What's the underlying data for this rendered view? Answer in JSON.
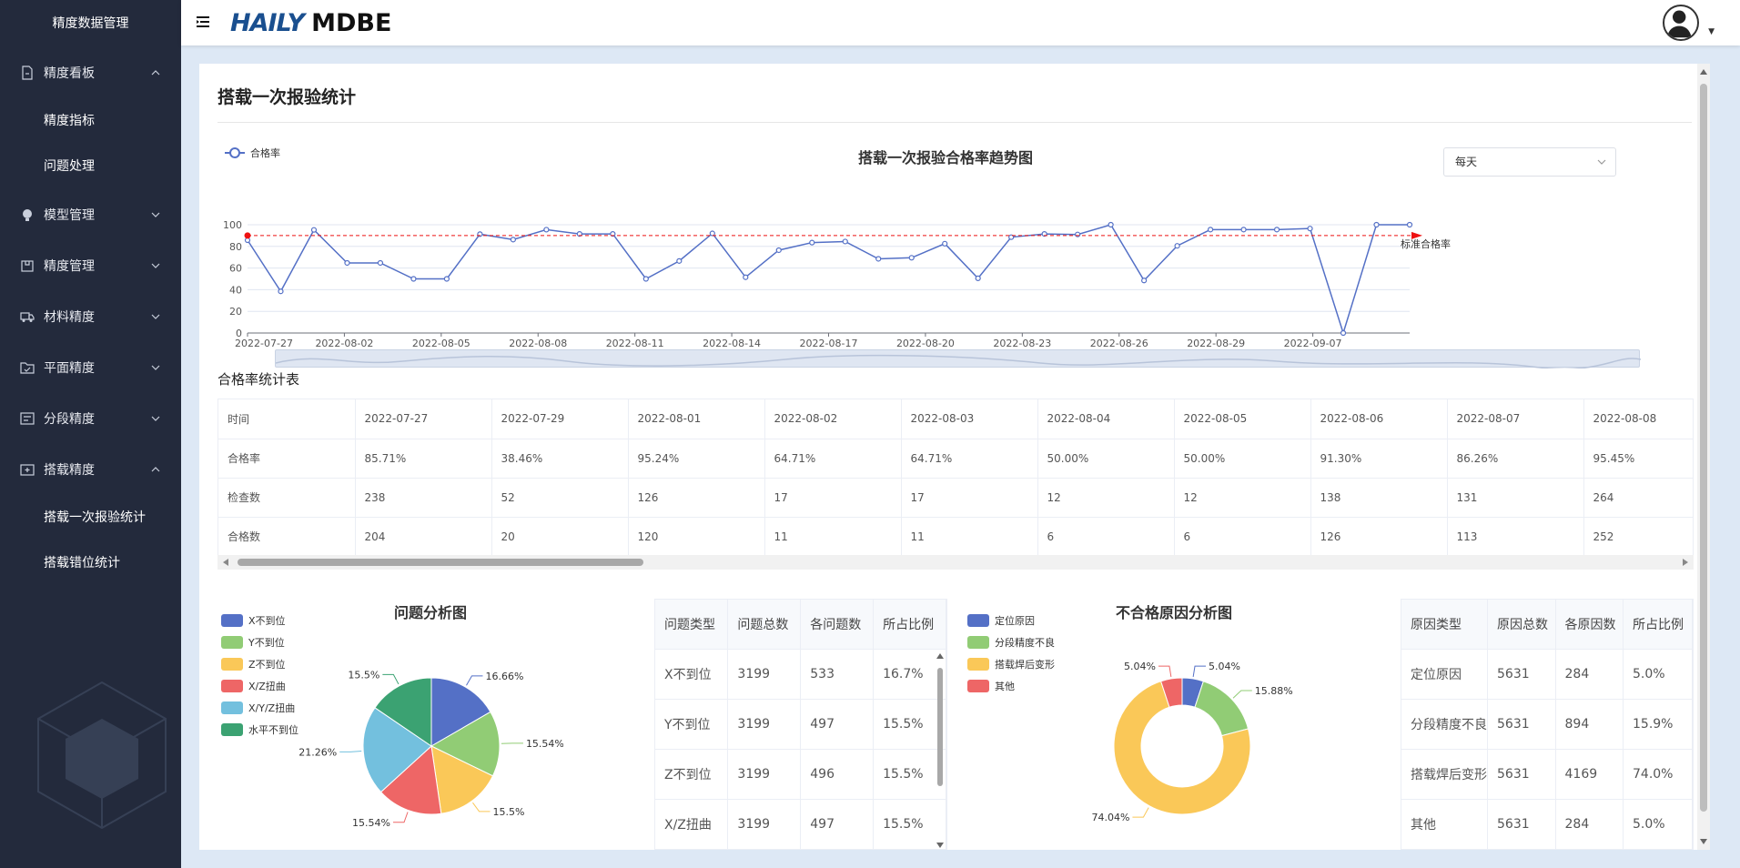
{
  "sidebar": {
    "title": "精度数据管理",
    "groups": [
      {
        "label": "精度看板",
        "icon": "document-icon",
        "subs": [
          "精度指标",
          "问题处理"
        ]
      },
      {
        "label": "模型管理",
        "icon": "bulb-icon"
      },
      {
        "label": "精度管理",
        "icon": "box-icon"
      },
      {
        "label": "材料精度",
        "icon": "truck-icon"
      },
      {
        "label": "平面精度",
        "icon": "folder-check-icon"
      },
      {
        "label": "分段精度",
        "icon": "list-icon"
      },
      {
        "label": "搭载精度",
        "icon": "plus-box-icon",
        "subs": [
          "搭载一次报验统计",
          "搭载错位统计"
        ]
      }
    ]
  },
  "header": {
    "logo_brand": "HAILY",
    "logo_product": "MDBE"
  },
  "page": {
    "title": "搭载一次报验统计"
  },
  "trend": {
    "title": "搭载一次报验合格率趋势图",
    "legend": "合格率",
    "period_select": "每天",
    "standard_label": "标准合格率",
    "colors": {
      "line": "#5470c6",
      "standard": "#ee1111"
    }
  },
  "chart_data": [
    {
      "type": "line",
      "title": "搭载一次报验合格率趋势图",
      "series": [
        {
          "name": "合格率",
          "values": [
            85.71,
            38.46,
            95.24,
            64.71,
            64.71,
            50.0,
            50.0,
            91.3,
            86.26,
            95.45,
            91.5,
            91.5,
            50.0,
            66.5,
            92.0,
            51.5,
            76.5,
            83.5,
            84.5,
            68.5,
            69.5,
            82.5,
            50.5,
            88.5,
            91.5,
            91.0,
            100,
            48.5,
            80.5,
            95.5,
            95.5,
            95.5,
            96.5,
            0,
            100,
            100
          ]
        }
      ],
      "x_tick_labels": [
        "2022-07-27",
        "2022-08-02",
        "2022-08-05",
        "2022-08-08",
        "2022-08-11",
        "2022-08-14",
        "2022-08-17",
        "2022-08-20",
        "2022-08-23",
        "2022-08-26",
        "2022-08-29",
        "2022-09-07"
      ],
      "y_ticks": [
        0,
        20,
        40,
        60,
        80,
        100
      ],
      "ylim": [
        0,
        100
      ],
      "standard_line": 90,
      "grid": true
    },
    {
      "type": "pie",
      "title": "问题分析图",
      "categories": [
        "X不到位",
        "Y不到位",
        "Z不到位",
        "X/Z扭曲",
        "X/Y/Z扭曲",
        "水平不到位"
      ],
      "values": [
        16.66,
        15.54,
        15.5,
        15.54,
        21.26,
        15.5
      ],
      "value_labels": [
        "16.66%",
        "15.54%",
        "15.5%",
        "15.54%",
        "21.26%",
        "15.5%"
      ],
      "colors": [
        "#5470c6",
        "#91cc75",
        "#fac858",
        "#ee6666",
        "#73c0de",
        "#3ba272"
      ]
    },
    {
      "type": "pie",
      "title": "不合格原因分析图",
      "categories": [
        "定位原因",
        "分段精度不良",
        "搭载焊后变形",
        "其他"
      ],
      "values": [
        5.04,
        15.88,
        74.04,
        5.04
      ],
      "value_labels": [
        "5.04%",
        "15.88%",
        "74.04%",
        "5.04%"
      ],
      "colors": [
        "#5470c6",
        "#91cc75",
        "#fac858",
        "#ee6666"
      ]
    }
  ],
  "stats": {
    "title": "合格率统计表",
    "rows": [
      [
        "时间",
        "2022-07-27",
        "2022-07-29",
        "2022-08-01",
        "2022-08-02",
        "2022-08-03",
        "2022-08-04",
        "2022-08-05",
        "2022-08-06",
        "2022-08-07",
        "2022-08-08"
      ],
      [
        "合格率",
        "85.71%",
        "38.46%",
        "95.24%",
        "64.71%",
        "64.71%",
        "50.00%",
        "50.00%",
        "91.30%",
        "86.26%",
        "95.45%"
      ],
      [
        "检查数",
        "238",
        "52",
        "126",
        "17",
        "17",
        "12",
        "12",
        "138",
        "131",
        "264"
      ],
      [
        "合格数",
        "204",
        "20",
        "120",
        "11",
        "11",
        "6",
        "6",
        "126",
        "113",
        "252"
      ]
    ]
  },
  "problem": {
    "title": "问题分析图",
    "table_headers": [
      "问题类型",
      "问题总数",
      "各问题数",
      "所占比例"
    ],
    "table_rows": [
      [
        "X不到位",
        "3199",
        "533",
        "16.7%"
      ],
      [
        "Y不到位",
        "3199",
        "497",
        "15.5%"
      ],
      [
        "Z不到位",
        "3199",
        "496",
        "15.5%"
      ],
      [
        "X/Z扭曲",
        "3199",
        "497",
        "15.5%"
      ]
    ]
  },
  "reason": {
    "title": "不合格原因分析图",
    "table_headers": [
      "原因类型",
      "原因总数",
      "各原因数",
      "所占比例"
    ],
    "table_rows": [
      [
        "定位原因",
        "5631",
        "284",
        "5.0%"
      ],
      [
        "分段精度不良",
        "5631",
        "894",
        "15.9%"
      ],
      [
        "搭载焊后变形",
        "5631",
        "4169",
        "74.0%"
      ],
      [
        "其他",
        "5631",
        "284",
        "5.0%"
      ]
    ]
  }
}
